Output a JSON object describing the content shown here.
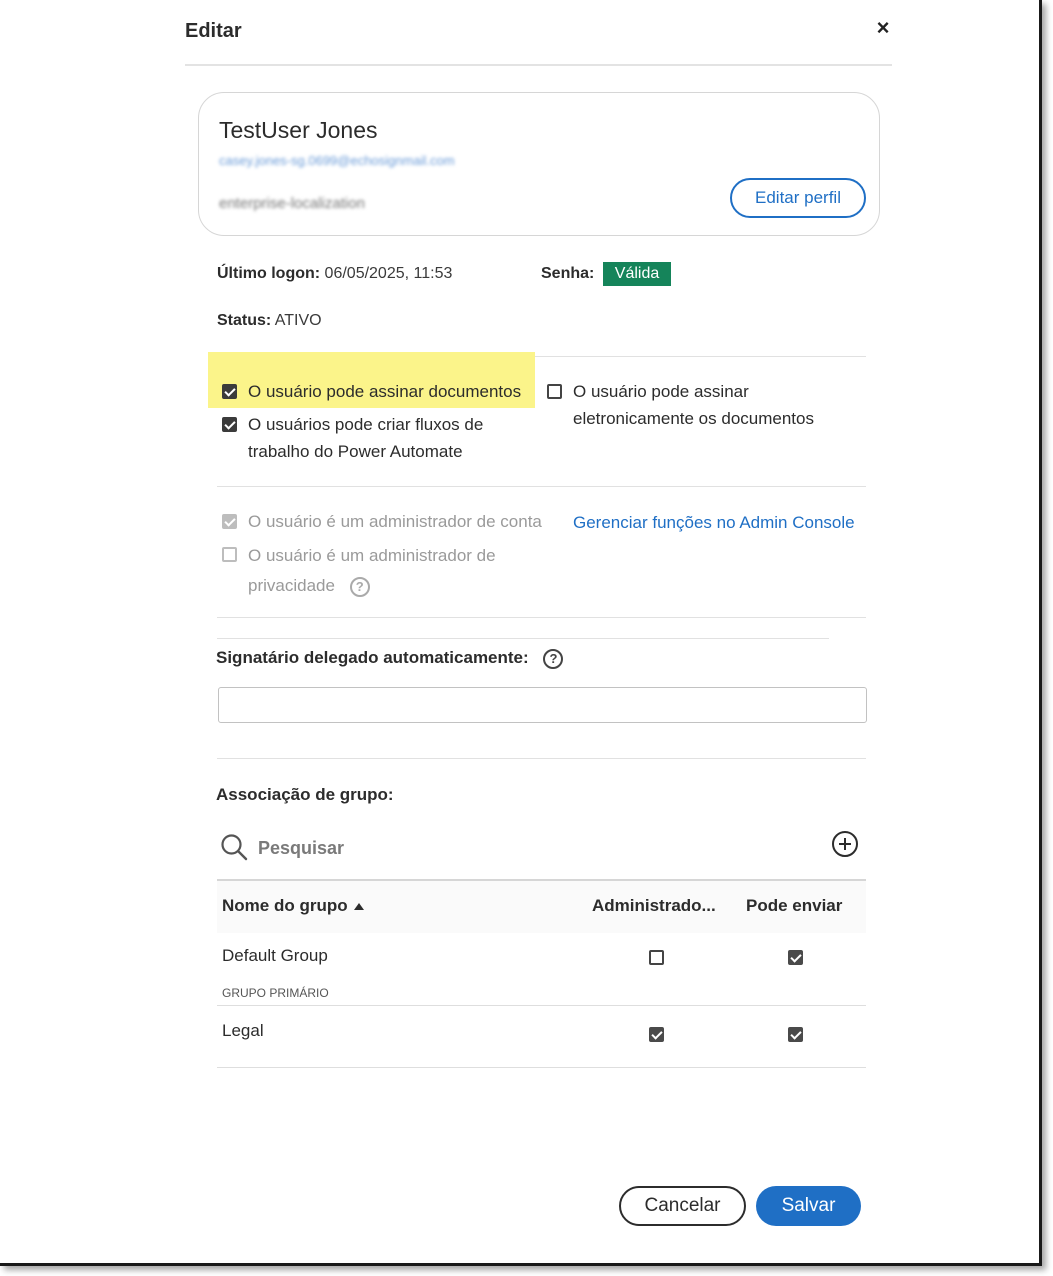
{
  "dialog": {
    "title": "Editar",
    "close_label": "×"
  },
  "profile": {
    "name": "TestUser Jones",
    "email": "casey.jones-sg.0699@echosignmail.com",
    "org": "enterprise-localization",
    "edit_label": "Editar perfil"
  },
  "info": {
    "last_logon_label": "Último logon:",
    "last_logon_value": "06/05/2025, 11:53",
    "password_label": "Senha:",
    "password_badge": "Válida",
    "status_label": "Status:",
    "status_value": "ATIVO"
  },
  "permissions": {
    "can_sign": {
      "label": "O usuário pode assinar documentos",
      "checked": true
    },
    "can_flows": {
      "label": "O usuários pode criar fluxos de trabalho do Power Automate",
      "checked": true
    },
    "can_esign": {
      "label": "O usuário pode assinar eletronicamente os documentos",
      "checked": false
    }
  },
  "admin": {
    "account_admin": {
      "label": "O usuário é um administrador de conta",
      "checked": true
    },
    "privacy_admin": {
      "label": "O usuário é um administrador de privacidade",
      "checked": false
    },
    "manage_link": "Gerenciar funções no Admin Console"
  },
  "delegate": {
    "label": "Signatário delegado automaticamente:",
    "value": ""
  },
  "groups": {
    "label": "Associação de grupo:",
    "search_placeholder": "Pesquisar",
    "columns": [
      "Nome do grupo",
      "Administrado...",
      "Pode enviar"
    ],
    "rows": [
      {
        "name": "Default Group",
        "sub": "GRUPO PRIMÁRIO",
        "admin": false,
        "send": true
      },
      {
        "name": "Legal",
        "sub": "",
        "admin": true,
        "send": true
      }
    ]
  },
  "footer": {
    "cancel_label": "Cancelar",
    "save_label": "Salvar"
  },
  "colors": {
    "accent": "#1f6fc5",
    "valid_badge": "#15845a",
    "highlight": "#fbf48a"
  }
}
